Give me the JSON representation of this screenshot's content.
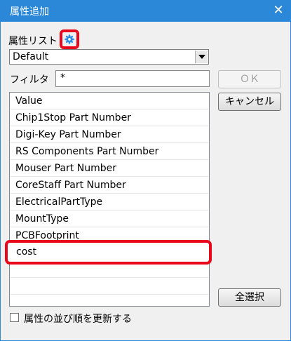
{
  "window": {
    "title": "属性追加",
    "close_glyph": "✕"
  },
  "attribute_list": {
    "label": "属性リスト",
    "settings_icon": "gear-icon",
    "selected": "Default"
  },
  "filter": {
    "label": "フィルタ",
    "value": "*"
  },
  "buttons": {
    "ok": "ＯＫ",
    "cancel": "キャンセル",
    "select_all": "全選択"
  },
  "attributes": [
    "Value",
    "Chip1Stop Part Number",
    "Digi-Key Part Number",
    "RS Components Part Number",
    "Mouser Part Number",
    "CoreStaff Part Number",
    "ElectricalPartType",
    "MountType",
    "PCBFootprint"
  ],
  "highlighted_attribute": "cost",
  "update_order_checkbox": {
    "label": "属性の並び順を更新する",
    "checked": false
  },
  "colors": {
    "titlebar": "#2b88d8",
    "highlight": "#e8071b",
    "gear": "#2f8be0"
  }
}
